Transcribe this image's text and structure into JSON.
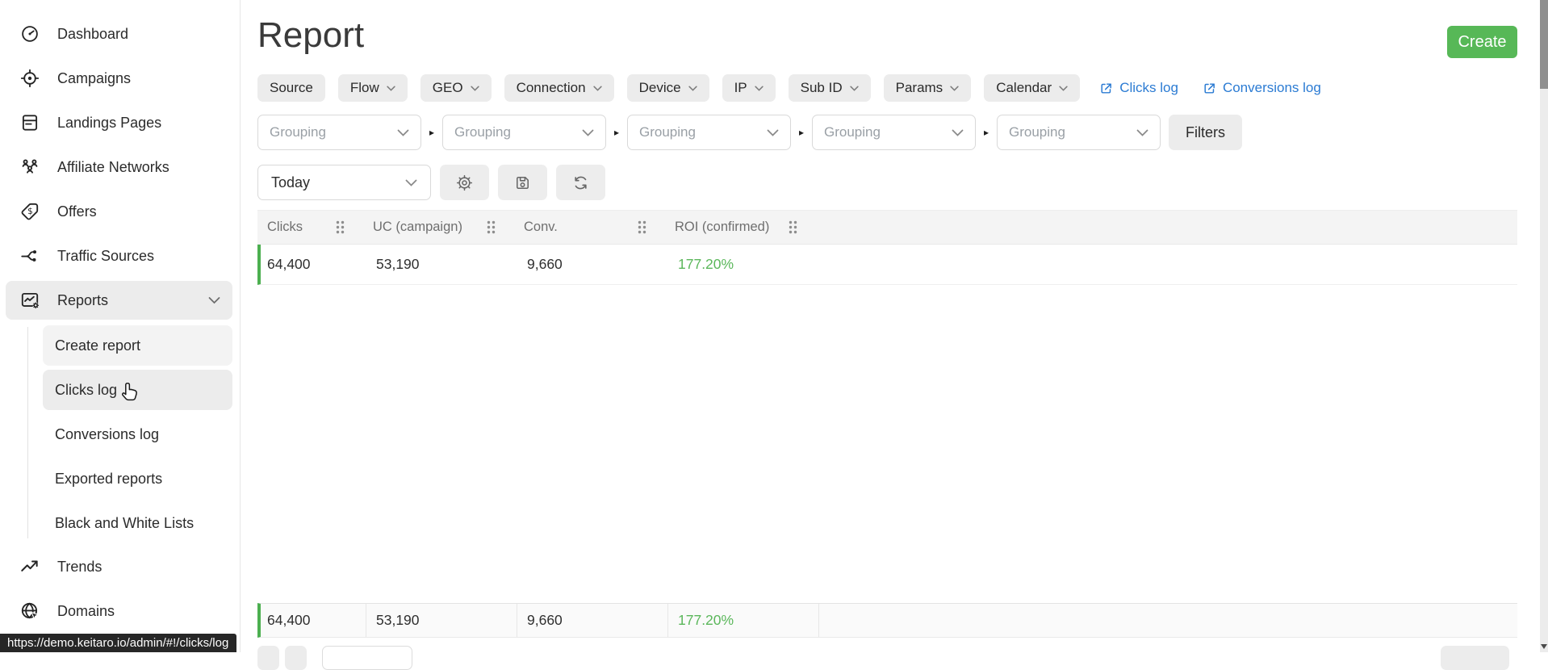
{
  "header": {
    "title": "Report",
    "create_label": "Create"
  },
  "sidebar": {
    "items": [
      {
        "label": "Dashboard",
        "icon": "dashboard-icon"
      },
      {
        "label": "Campaigns",
        "icon": "campaigns-icon"
      },
      {
        "label": "Landings Pages",
        "icon": "landing-pages-icon"
      },
      {
        "label": "Affiliate Networks",
        "icon": "affiliate-networks-icon"
      },
      {
        "label": "Offers",
        "icon": "offers-icon"
      },
      {
        "label": "Traffic Sources",
        "icon": "traffic-sources-icon"
      },
      {
        "label": "Reports",
        "icon": "reports-icon",
        "expanded": true
      },
      {
        "label": "Trends",
        "icon": "trends-icon"
      },
      {
        "label": "Domains",
        "icon": "domains-icon"
      }
    ],
    "submenu": [
      {
        "label": "Create report"
      },
      {
        "label": "Clicks log",
        "hovered": true
      },
      {
        "label": "Conversions log"
      },
      {
        "label": "Exported reports"
      },
      {
        "label": "Black and White Lists"
      }
    ]
  },
  "filters": {
    "buttons": [
      {
        "label": "Source",
        "chevron": false
      },
      {
        "label": "Flow",
        "chevron": true
      },
      {
        "label": "GEO",
        "chevron": true
      },
      {
        "label": "Connection",
        "chevron": true
      },
      {
        "label": "Device",
        "chevron": true
      },
      {
        "label": "IP",
        "chevron": true
      },
      {
        "label": "Sub ID",
        "chevron": true
      },
      {
        "label": "Params",
        "chevron": true
      },
      {
        "label": "Calendar",
        "chevron": true
      }
    ],
    "links": [
      {
        "label": "Clicks log"
      },
      {
        "label": "Conversions log"
      }
    ]
  },
  "grouping": {
    "placeholder": "Grouping",
    "separator": "▸",
    "filters_label": "Filters"
  },
  "toolbar": {
    "date_range": "Today"
  },
  "table": {
    "columns": [
      "Clicks",
      "UC (campaign)",
      "Conv.",
      "ROI (confirmed)"
    ],
    "row": {
      "clicks": "64,400",
      "uc": "53,190",
      "conv": "9,660",
      "roi": "177.20%"
    },
    "totals": {
      "clicks": "64,400",
      "uc": "53,190",
      "conv": "9,660",
      "roi": "177.20%"
    }
  },
  "statusbar": {
    "url": "https://demo.keitaro.io/admin/#!/clicks/log"
  },
  "colors": {
    "create_green": "#57b857",
    "roi_green": "#5bb75b",
    "row_border_green": "#4caf50",
    "link_blue": "#2b7bd3"
  }
}
